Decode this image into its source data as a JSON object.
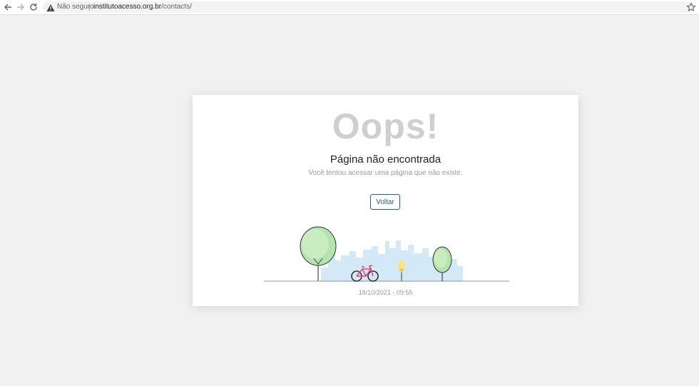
{
  "browser": {
    "security_label": "Não seguro",
    "url_domain": "institutoacesso.org.br",
    "url_path": "/contacts/"
  },
  "error_page": {
    "headline": "Oops!",
    "title": "Página não encontrada",
    "message": "Você tentou acessar uma página que não existe.",
    "back_button_label": "Voltar",
    "timestamp": "18/10/2021 - 09:55"
  },
  "colors": {
    "accent": "#2b5a8a",
    "tree_green": "#b6e3ad",
    "bike_pink": "#e0457b",
    "city_blue": "#cfe6f7"
  },
  "icons": [
    "back-arrow-icon",
    "forward-arrow-icon",
    "reload-icon",
    "warning-icon",
    "bookmark-star-icon"
  ]
}
